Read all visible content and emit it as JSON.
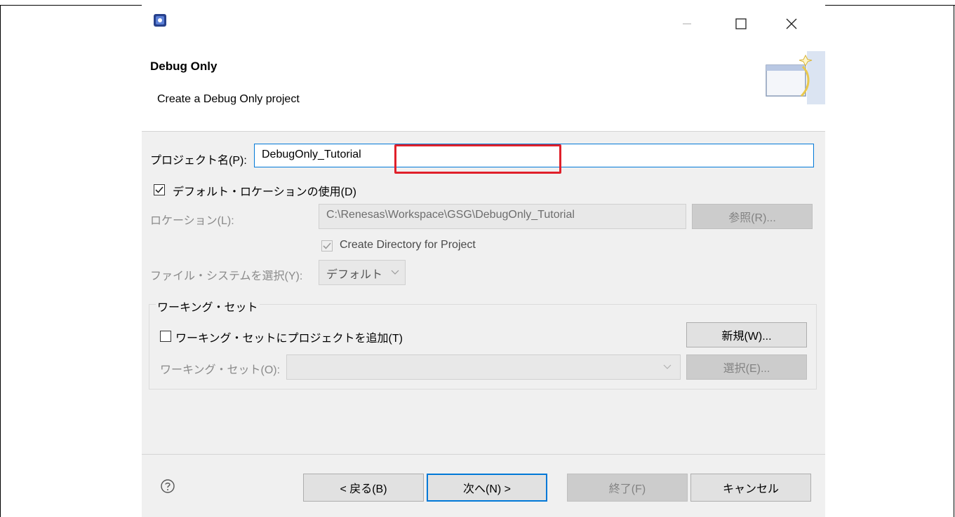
{
  "wizard": {
    "title": "Debug Only",
    "subtitle": "Create a Debug Only project"
  },
  "project_name": {
    "label": "プロジェクト名(P):",
    "value": "DebugOnly_Tutorial"
  },
  "default_location": {
    "label": "デフォルト・ロケーションの使用(D)",
    "checked": true
  },
  "location": {
    "label": "ロケーション(L):",
    "value": "C:\\Renesas\\Workspace\\GSG\\DebugOnly_Tutorial",
    "browse_label": "参照(R)..."
  },
  "create_directory": {
    "label": "Create Directory for Project",
    "checked": true
  },
  "file_system": {
    "label": "ファイル・システムを選択(Y):",
    "selected": "デフォルト"
  },
  "working_sets": {
    "group_title": "ワーキング・セット",
    "add_label": "ワーキング・セットにプロジェクトを追加(T)",
    "add_checked": false,
    "new_label": "新規(W)...",
    "field_label": "ワーキング・セット(O):",
    "select_label": "選択(E)..."
  },
  "footer": {
    "back_label": "< 戻る(B)",
    "next_label": "次へ(N) >",
    "finish_label": "終了(F)",
    "cancel_label": "キャンセル"
  },
  "colors": {
    "highlight": "#e0202a",
    "default_button_border": "#0078d7"
  },
  "icons": [
    "app-icon",
    "minimize-icon",
    "maximize-icon",
    "close-icon",
    "wizard-banner-icon",
    "checkmark-icon",
    "chevron-down-icon",
    "help-icon"
  ]
}
